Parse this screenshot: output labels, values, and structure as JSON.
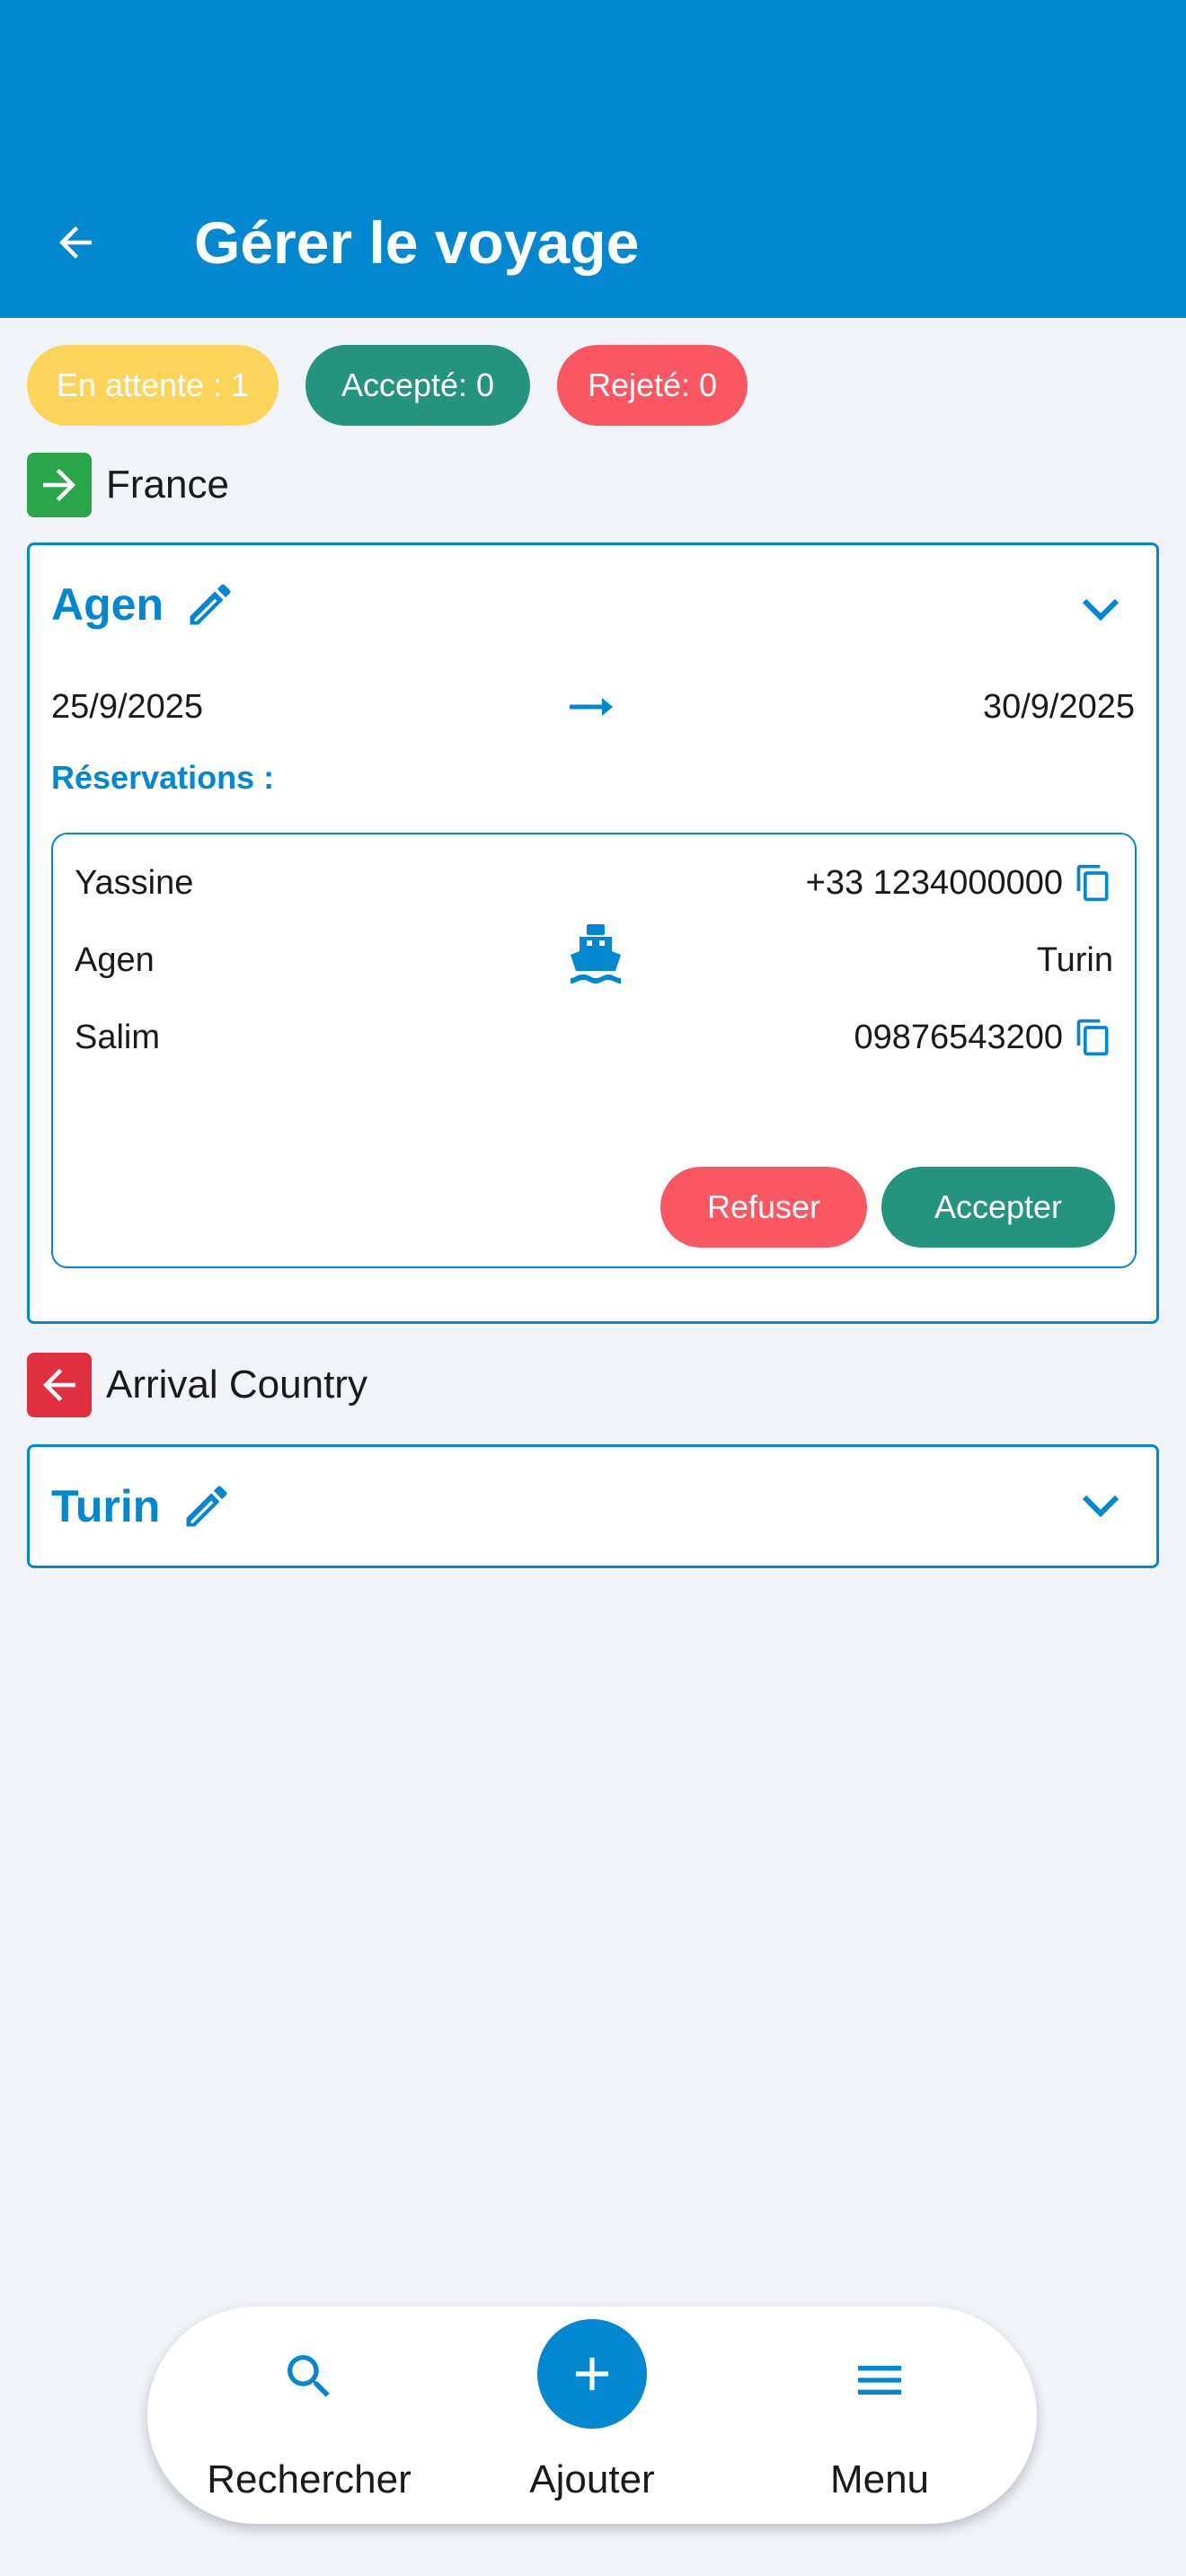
{
  "header": {
    "title": "Gérer le voyage",
    "back_icon": "arrow-left-icon"
  },
  "status": {
    "pending": "En attente : 1",
    "accepted": "Accepté: 0",
    "rejected": "Rejeté: 0",
    "colors": {
      "pending": "#fdd45a",
      "accepted": "#25947f",
      "rejected": "#fa5762"
    }
  },
  "departure": {
    "label": "France",
    "icon": "arrow-right-icon",
    "icon_color": "#2ba64a",
    "city": "Agen",
    "start_date": "25/9/2025",
    "end_date": "30/9/2025",
    "reservations_label": "Réservations :",
    "reservation": {
      "client_name": "Yassine",
      "client_phone": "+33 1234000000",
      "from_city": "Agen",
      "to_city": "Turin",
      "transport_icon": "boat-icon",
      "contact_name": "Salim",
      "contact_phone": "09876543200",
      "refuse_label": "Refuser",
      "accept_label": "Accepter"
    }
  },
  "arrival": {
    "label": "Arrival Country",
    "icon": "arrow-left-icon",
    "icon_color": "#e0303f",
    "city": "Turin"
  },
  "nav": {
    "search": "Rechercher",
    "add": "Ajouter",
    "menu": "Menu"
  },
  "theme": {
    "primary": "#0288d1",
    "background": "#f0f4f9"
  }
}
